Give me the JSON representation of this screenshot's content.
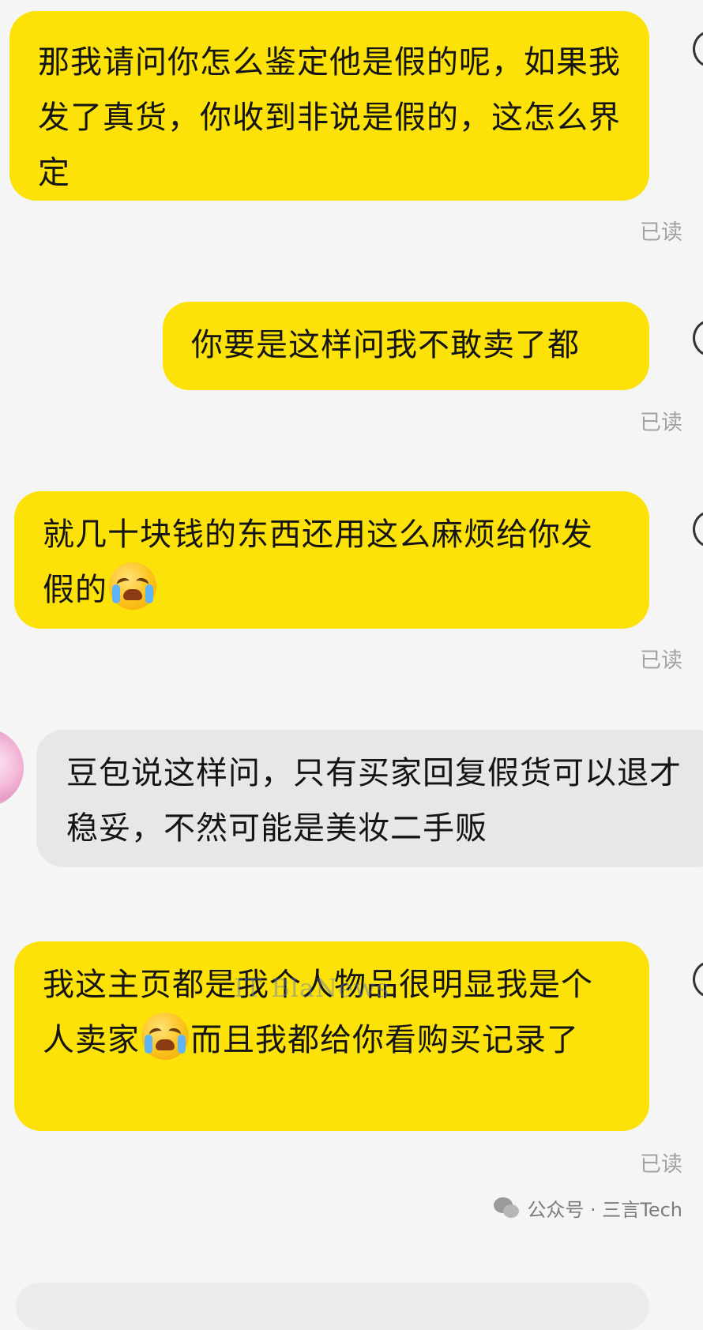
{
  "chat": {
    "messages": [
      {
        "sender": "me",
        "text": "那我请问你怎么鉴定他是假的呢，如果我发了真货，你收到非说是假的，这怎么界定",
        "status": "已读"
      },
      {
        "sender": "me",
        "text": "你要是这样问我不敢卖了都",
        "status": "已读"
      },
      {
        "sender": "me",
        "text_before_emoji": "就几十块钱的东西还用这么麻烦给你发假的",
        "emoji": "loudly-crying-face",
        "text_after_emoji": "",
        "status": "已读"
      },
      {
        "sender": "other",
        "text": "豆包说这样问，只有买家回复假货可以退才稳妥，不然可能是美妆二手贩"
      },
      {
        "sender": "me",
        "text_before_emoji": "我这主页都是我个人物品很明显我是个人卖家",
        "emoji": "loudly-crying-face",
        "text_after_emoji": "而且我都给你看购买记录了",
        "status": "已读"
      }
    ]
  },
  "watermark": {
    "text": "IT BlaNews"
  },
  "footer": {
    "account": "公众号 · 三言Tech"
  },
  "colors": {
    "my_bubble": "#fde20a",
    "their_bubble": "#e7e7ea",
    "background": "#f5f5f5",
    "read_status": "#a2a2a2"
  }
}
